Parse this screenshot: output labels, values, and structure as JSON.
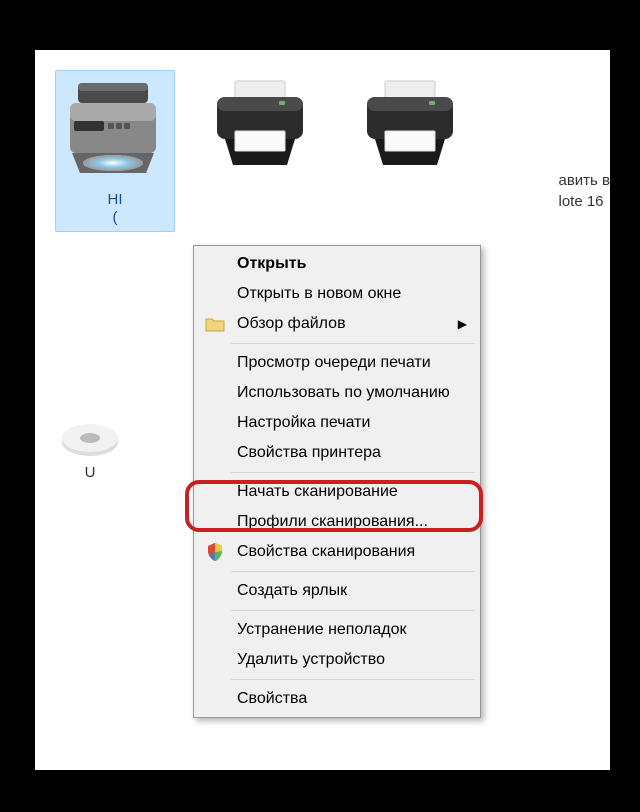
{
  "devices": {
    "selected": {
      "label_line1": "HI",
      "label_line2": "("
    },
    "printer2_label": "",
    "partial_right_line1": "авить в",
    "partial_right_line2": "lote 16",
    "usb_label": "U"
  },
  "context_menu": {
    "open": "Открыть",
    "open_new_window": "Открыть в новом окне",
    "browse_files": "Обзор файлов",
    "view_queue": "Просмотр очереди печати",
    "set_default": "Использовать по умолчанию",
    "print_settings": "Настройка печати",
    "printer_properties": "Свойства принтера",
    "start_scan": "Начать сканирование",
    "scan_profiles": "Профили сканирования...",
    "scan_properties": "Свойства сканирования",
    "create_shortcut": "Создать ярлык",
    "troubleshoot": "Устранение неполадок",
    "remove_device": "Удалить устройство",
    "properties": "Свойства"
  }
}
